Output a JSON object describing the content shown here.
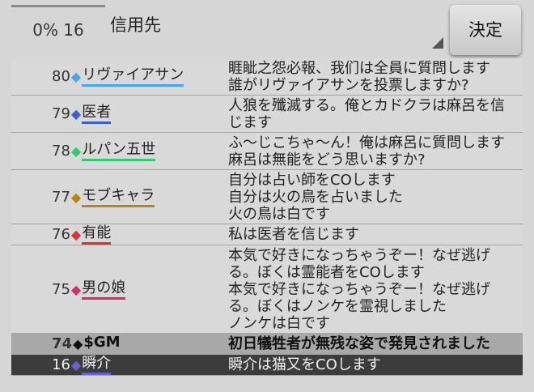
{
  "header": {
    "counter": "0% 16",
    "target_label": "信用先",
    "decide_label": "決定"
  },
  "log": [
    {
      "num": "80",
      "name": "リヴァイアサン",
      "color": "#4aa3f0",
      "msg": "睚眦之怨必報、我们は全員に質問します\n誰がリヴァイアサンを投票しますか?"
    },
    {
      "num": "79",
      "name": "医者",
      "color": "#3a5fd0",
      "msg": "人狼を殲滅する。俺とカドクラは麻呂を信\nじます"
    },
    {
      "num": "78",
      "name": "ルパン五世",
      "color": "#2ecc71",
      "msg": "ふ～じこちゃ～ん！俺は麻呂に質問します\n麻呂は無能をどう思いますか?"
    },
    {
      "num": "77",
      "name": "モブキャラ",
      "color": "#b8860b",
      "msg": "自分は占い師をCOします\n自分は火の鳥を占いました\n火の鳥は白です"
    },
    {
      "num": "76",
      "name": "有能",
      "color": "#e03030",
      "msg": "私は医者を信じます"
    },
    {
      "num": "75",
      "name": "男の娘",
      "color": "#d0306a",
      "msg": "本気で好きになっちゃうぞー！なぜ逃げ\nる。ぼくは霊能者をCOします\n本気で好きになっちゃうぞー！なぜ逃げ\nる。ぼくはノンケを霊視しました\nノンケは白です"
    },
    {
      "num": "74",
      "name": "$GM",
      "color": "#111111",
      "msg": "初日犠牲者が無残な姿で発見されました",
      "type": "gm"
    },
    {
      "num": "16",
      "name": "瞬介",
      "color": "#6b5fd6",
      "msg": "瞬介は猫又をCOします",
      "type": "dark"
    }
  ]
}
